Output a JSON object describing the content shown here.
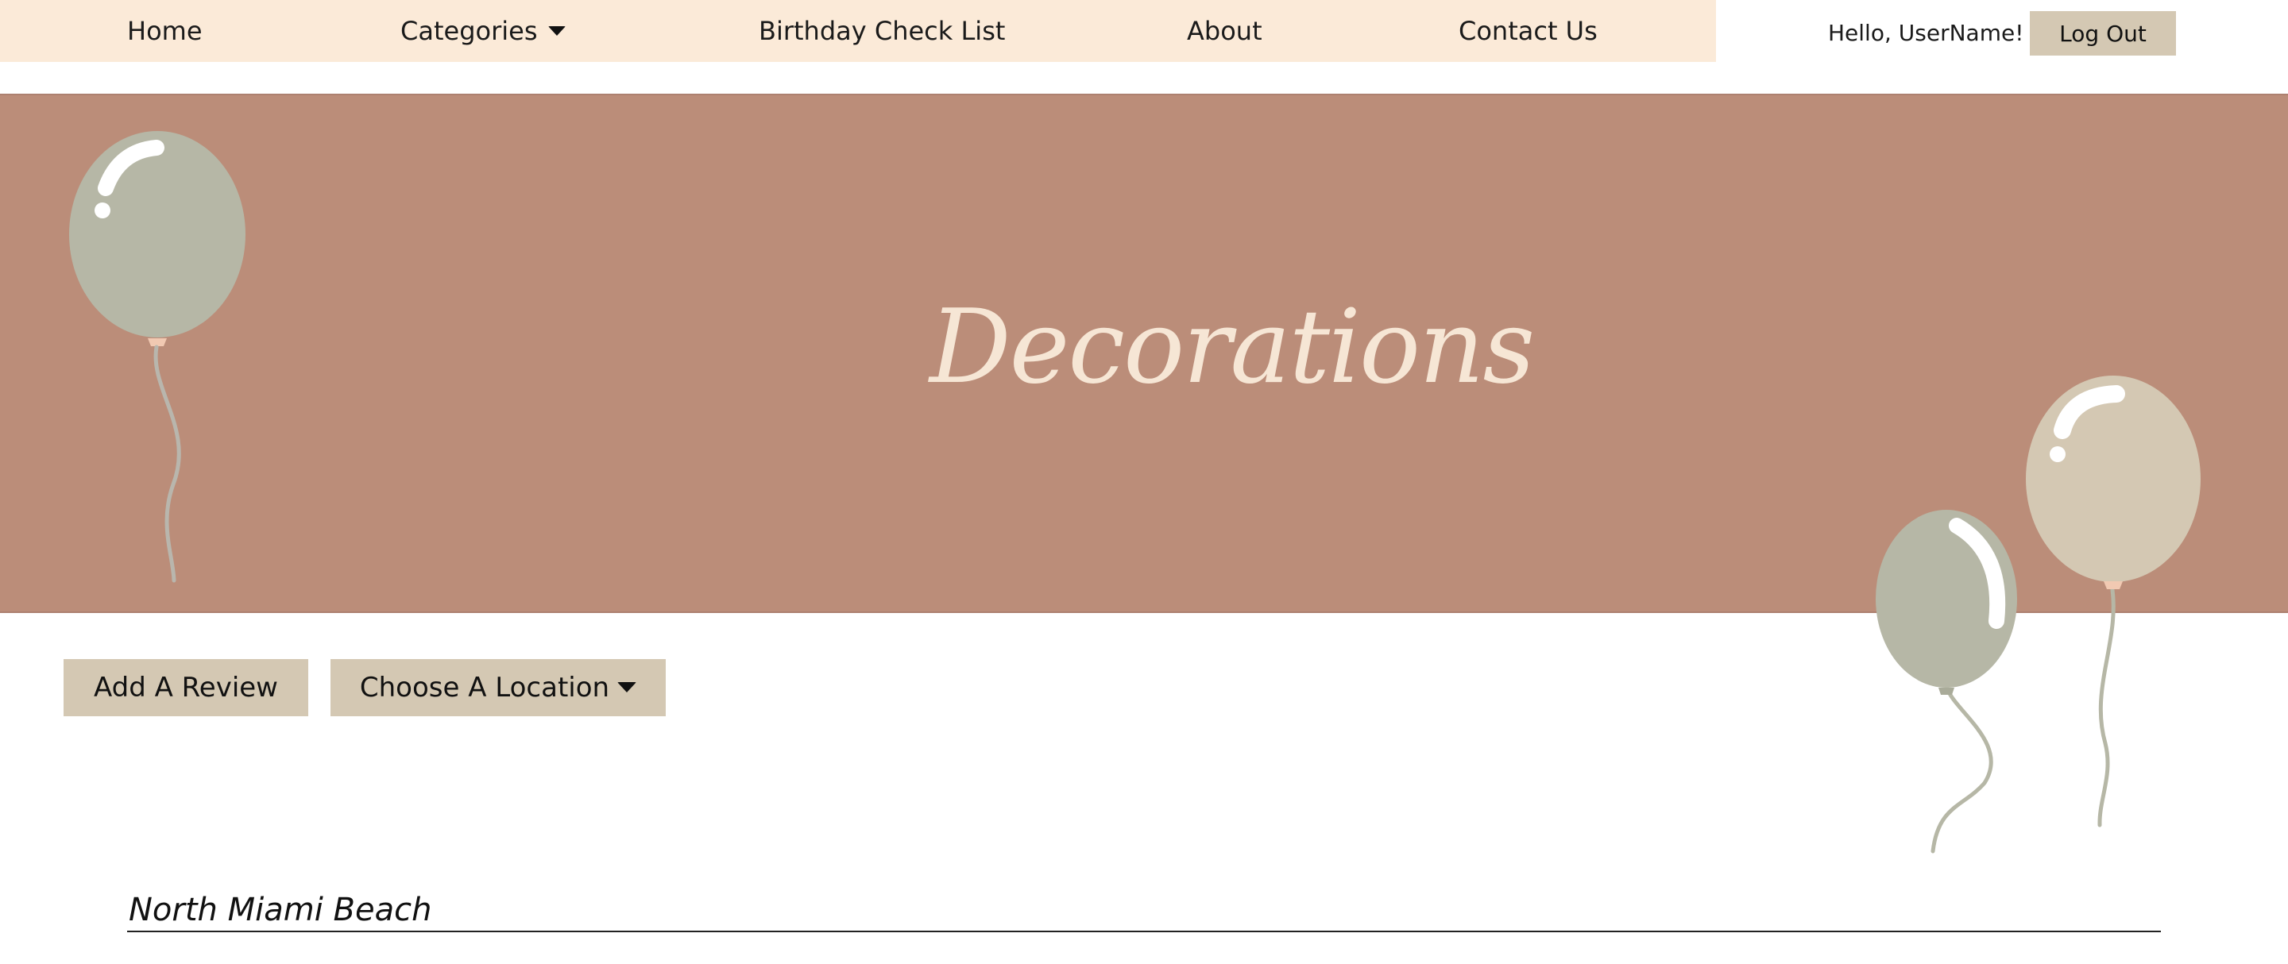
{
  "nav": {
    "items": [
      {
        "label": "Home"
      },
      {
        "label": "Categories"
      },
      {
        "label": "Birthday Check List"
      },
      {
        "label": "About"
      },
      {
        "label": "Contact Us"
      }
    ],
    "categories_dropdown_icon": "caret-down-icon"
  },
  "user": {
    "greeting": "Hello, UserName!",
    "logout_label": "Log Out"
  },
  "banner": {
    "title": "Decorations",
    "decoration_icon": "balloon-icon"
  },
  "actions": {
    "review_label": "Add A Review",
    "location_label": "Choose A Location",
    "location_icon": "caret-down-icon"
  },
  "section": {
    "location_name": "North Miami Beach"
  },
  "colors": {
    "nav_background": "#fbead8",
    "banner_background": "#bb8d79",
    "button_background": "#d4c8b3",
    "title_color": "#f6e6d5",
    "balloon_sage": "#b6b7a6",
    "balloon_beige": "#d4c8b3"
  }
}
